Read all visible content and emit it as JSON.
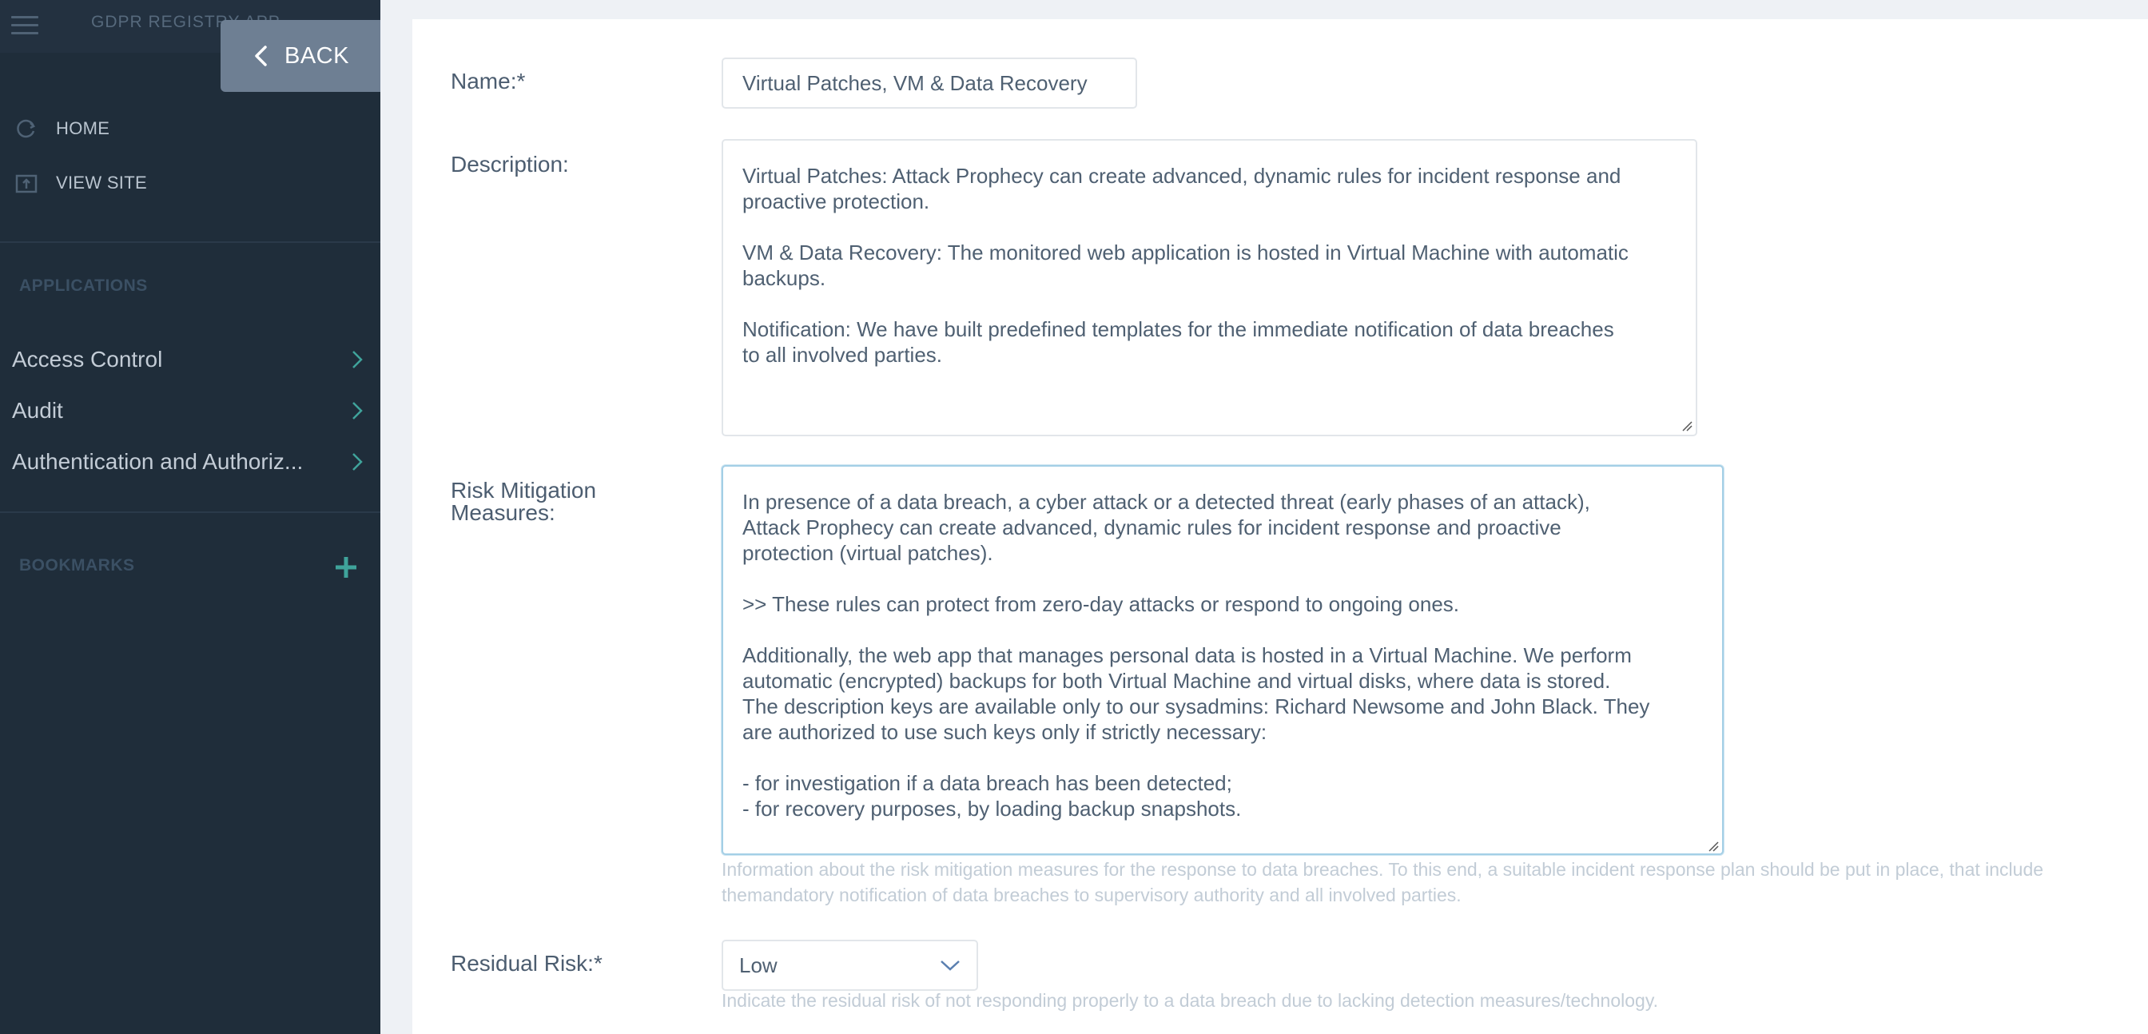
{
  "app": {
    "title": "GDPR REGISTRY APP",
    "back_label": "BACK"
  },
  "sidebar": {
    "links": [
      {
        "label": "HOME",
        "icon": "refresh-icon"
      },
      {
        "label": "VIEW SITE",
        "icon": "external-view-icon"
      }
    ],
    "applications_label": "APPLICATIONS",
    "applications": [
      {
        "label": "Access Control"
      },
      {
        "label": "Audit"
      },
      {
        "label": "Authentication and Authoriz..."
      }
    ],
    "bookmarks_label": "BOOKMARKS",
    "accent_color": "#3fa39b"
  },
  "form": {
    "name": {
      "label": "Name:*",
      "value": "Virtual Patches, VM & Data Recovery"
    },
    "description": {
      "label": "Description:",
      "value": "Virtual Patches: Attack Prophecy can create advanced, dynamic rules for incident response and\nproactive protection.\n\nVM & Data Recovery: The monitored web application is hosted in Virtual Machine with automatic\nbackups.\n\nNotification: We have built predefined templates for the immediate notification of data breaches\nto all involved parties."
    },
    "risk_mitigation": {
      "label": "Risk Mitigation Measures:",
      "value": "In presence of a data breach, a cyber attack or a detected threat (early phases of an attack),\nAttack Prophecy can create advanced, dynamic rules for incident response and proactive\nprotection (virtual patches).\n\n>> These rules can protect from zero-day attacks or respond to ongoing ones.\n\nAdditionally, the web app that manages personal data is hosted in a Virtual Machine. We perform\nautomatic (encrypted) backups for both Virtual Machine and virtual disks, where data is stored.\nThe description keys are available only to our sysadmins: Richard Newsome and John Black. They\nare authorized to use such keys only if strictly necessary:\n\n- for investigation if a data breach has been detected;\n- for recovery purposes, by loading backup snapshots.",
      "help_line1": "Information about the risk mitigation measures for the response to data breaches. To this end, a suitable incident response plan should be put in place, that include",
      "help_line2": "themandatory notification of data breaches to supervisory authority and all involved parties."
    },
    "residual_risk": {
      "label": "Residual Risk:*",
      "selected": "Low",
      "help": "Indicate the residual risk of not responding properly to a data breach due to lacking detection measures/technology."
    }
  }
}
